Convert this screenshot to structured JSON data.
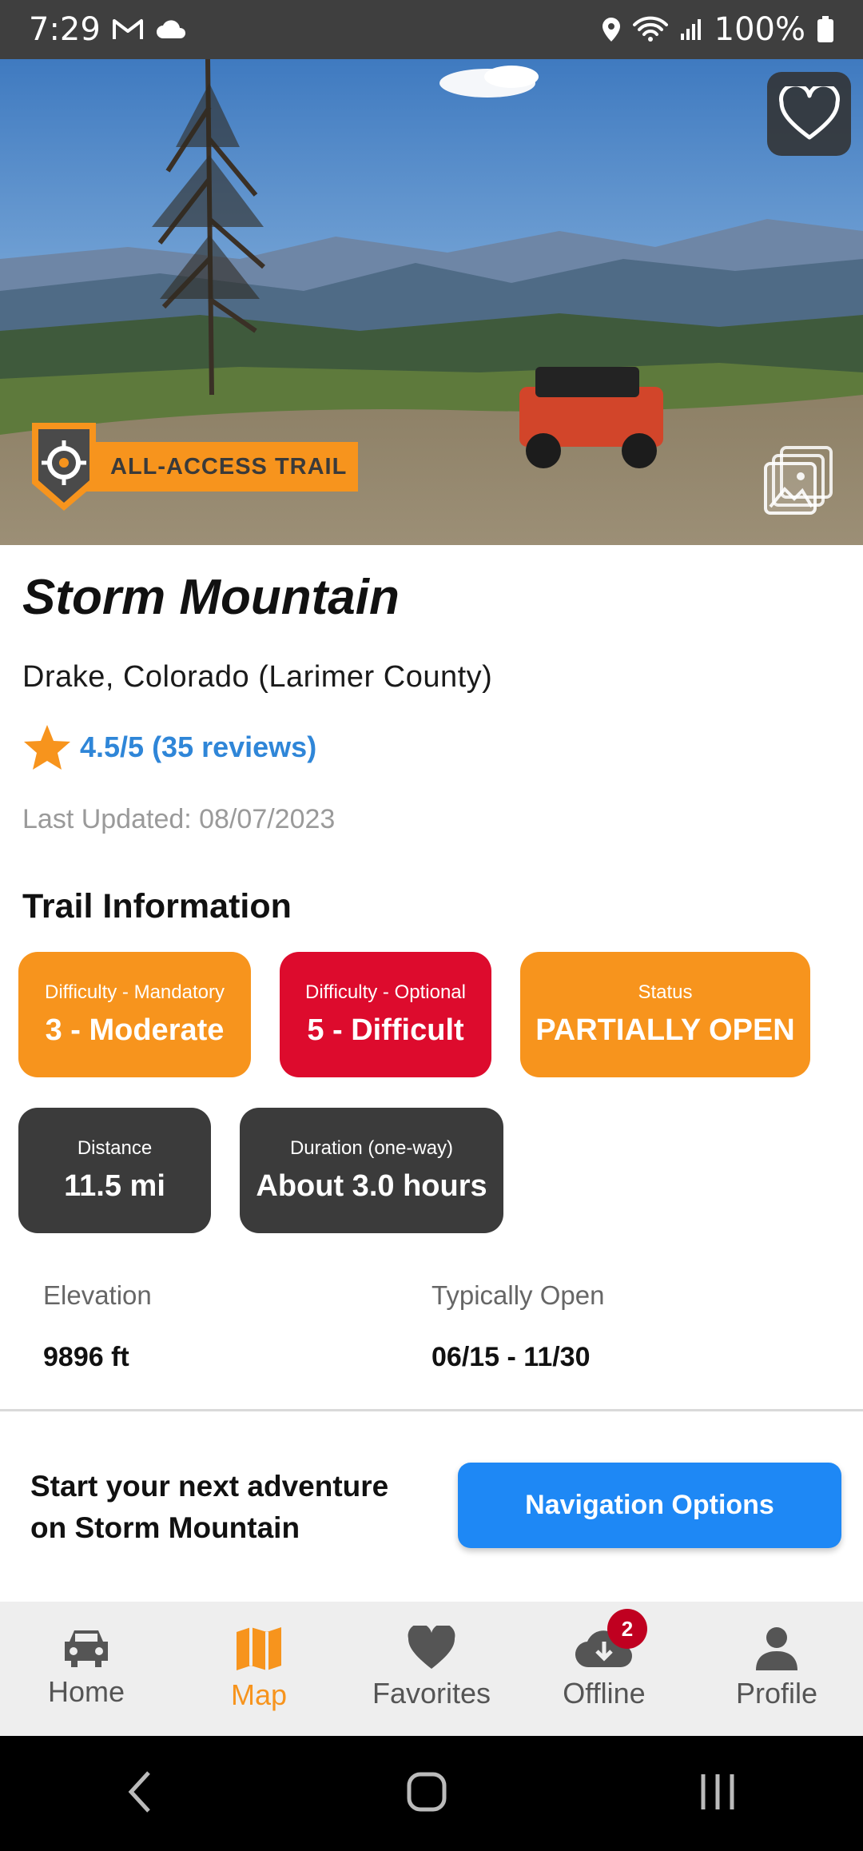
{
  "status_bar": {
    "time": "7:29",
    "battery": "100%"
  },
  "hero": {
    "badge_label": "ALL-ACCESS TRAIL",
    "favorite_icon": "heart-outline-icon",
    "gallery_icon": "gallery-icon"
  },
  "trail": {
    "name": "Storm Mountain",
    "location": "Drake, Colorado (Larimer County)",
    "rating": "4.5/5 (35 reviews)",
    "last_updated": "Last Updated: 08/07/2023"
  },
  "info": {
    "section_title": "Trail Information",
    "chips": [
      {
        "caption": "Difficulty - Mandatory",
        "value": "3 - Moderate",
        "color": "#f7941d"
      },
      {
        "caption": "Difficulty - Optional",
        "value": "5 - Difficult",
        "color": "#dd0b2d"
      },
      {
        "caption": "Status",
        "value": "PARTIALLY OPEN",
        "color": "#f7941d"
      },
      {
        "caption": "Distance",
        "value": "11.5 mi",
        "color": "#3b3b3b"
      },
      {
        "caption": "Duration (one-way)",
        "value": "About 3.0 hours",
        "color": "#3b3b3b"
      }
    ],
    "elevation_label": "Elevation",
    "elevation_value": "9896 ft",
    "open_label": "Typically Open",
    "open_value": "06/15 - 11/30"
  },
  "cta": {
    "line1": "Start your next adventure",
    "line2": "on Storm Mountain",
    "button": "Navigation Options"
  },
  "bottom_nav": {
    "items": [
      {
        "label": "Home",
        "icon": "car-icon"
      },
      {
        "label": "Map",
        "icon": "map-icon",
        "active": true
      },
      {
        "label": "Favorites",
        "icon": "heart-icon"
      },
      {
        "label": "Offline",
        "icon": "cloud-download-icon",
        "badge": "2"
      },
      {
        "label": "Profile",
        "icon": "person-icon"
      }
    ]
  },
  "colors": {
    "accent_orange": "#f7941d",
    "difficult_red": "#dd0b2d",
    "link_blue": "#2f86d8",
    "button_blue": "#1e88f5"
  }
}
